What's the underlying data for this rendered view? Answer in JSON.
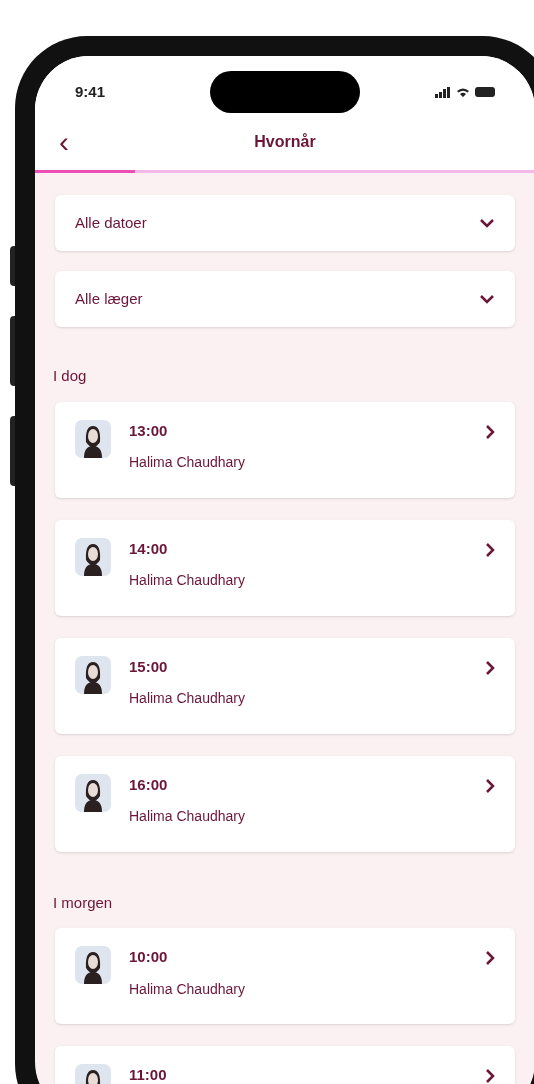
{
  "status_bar": {
    "time": "9:41"
  },
  "header": {
    "back": "‹",
    "title": "Hvornår",
    "progress": {
      "level": 0.2
    }
  },
  "filters": [
    {
      "label": "Alle datoer"
    },
    {
      "label": "Alle læger"
    }
  ],
  "sections": [
    {
      "title": "I dog",
      "slots": [
        {
          "time": "13:00",
          "doctor": "Halima Chaudhary"
        },
        {
          "time": "14:00",
          "doctor": "Halima Chaudhary"
        },
        {
          "time": "15:00",
          "doctor": "Halima Chaudhary"
        },
        {
          "time": "16:00",
          "doctor": "Halima Chaudhary"
        }
      ]
    },
    {
      "title": "I morgen",
      "slots": [
        {
          "time": "10:00",
          "doctor": "Halima Chaudhary"
        },
        {
          "time": "11:00"
        }
      ]
    }
  ]
}
